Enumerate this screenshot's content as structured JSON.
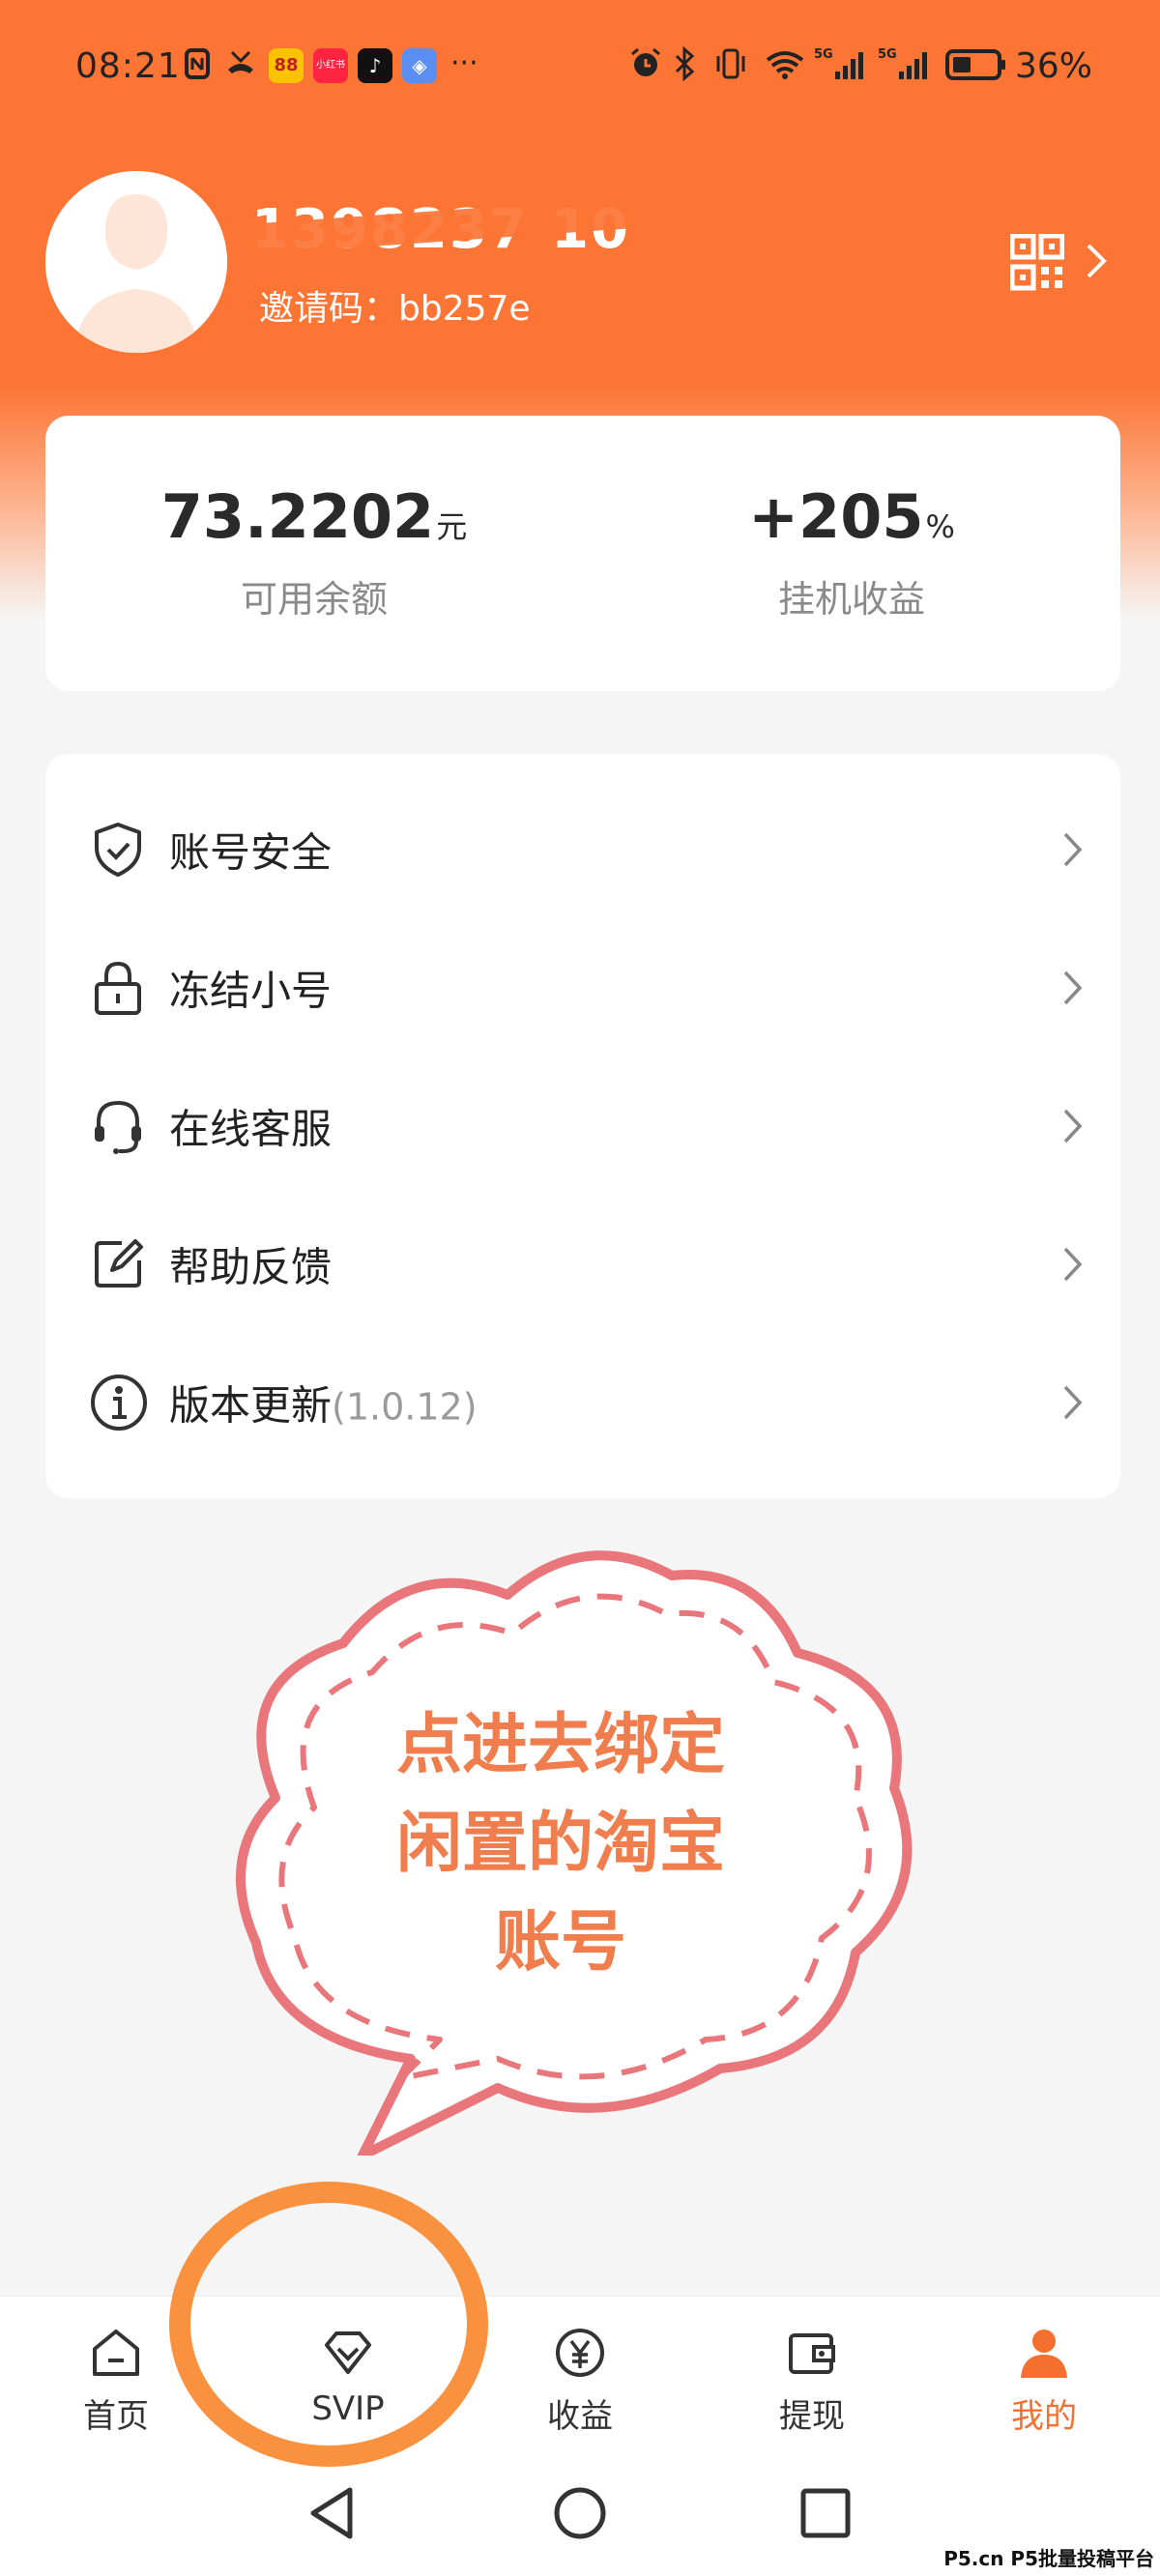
{
  "status_bar": {
    "time": "08:21",
    "battery": "36%",
    "app_badges": [
      "小红书"
    ]
  },
  "profile": {
    "phone": "1398237",
    "phone_tail": "10",
    "invite": "邀请码：bb257e"
  },
  "stats": {
    "balance_value": "73.2202",
    "balance_unit": "元",
    "balance_label": "可用余额",
    "earnings_value": "+205",
    "earnings_unit": "%",
    "earnings_label": "挂机收益"
  },
  "menu": {
    "items": [
      {
        "label": "账号安全",
        "icon": "shield-check-icon"
      },
      {
        "label": "冻结小号",
        "icon": "lock-icon"
      },
      {
        "label": "在线客服",
        "icon": "headset-icon"
      },
      {
        "label": "帮助反馈",
        "icon": "edit-icon"
      },
      {
        "label": "版本更新",
        "icon": "info-icon",
        "suffix": "(1.0.12)"
      }
    ]
  },
  "annotation": {
    "lines": [
      "点进去绑定",
      "闲置的淘宝",
      "账号"
    ]
  },
  "bottom_nav": {
    "items": [
      {
        "label": "首页",
        "icon": "home-icon"
      },
      {
        "label": "SVIP",
        "icon": "diamond-icon"
      },
      {
        "label": "收益",
        "icon": "yen-coin-icon"
      },
      {
        "label": "提现",
        "icon": "wallet-icon"
      },
      {
        "label": "我的",
        "icon": "user-icon"
      }
    ],
    "active_index": 4
  },
  "watermark": "P5.cn P5批量投稿平台",
  "colors": {
    "brand": "#fc7535",
    "accent": "#f5702f",
    "annotation": "#e8767a"
  }
}
